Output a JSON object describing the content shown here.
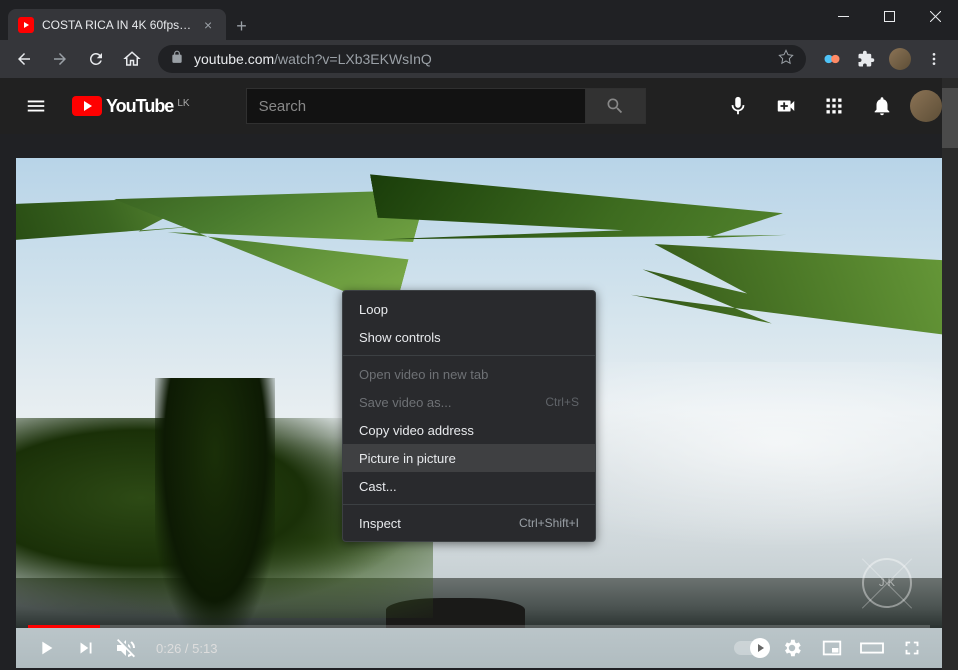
{
  "browser": {
    "tab": {
      "title": "COSTA RICA IN 4K 60fps HDR (U..."
    },
    "url": {
      "domain": "youtube.com",
      "path": "/watch?v=LXb3EKWsInQ"
    }
  },
  "youtube": {
    "logo_text": "YouTube",
    "country": "LK",
    "search_placeholder": "Search"
  },
  "player": {
    "time_current": "0:26",
    "time_separator": " / ",
    "time_total": "5:13",
    "progress_percent": 8,
    "watermark": "J K"
  },
  "context_menu": {
    "items": [
      {
        "label": "Loop",
        "shortcut": "",
        "disabled": false,
        "highlighted": false
      },
      {
        "label": "Show controls",
        "shortcut": "",
        "disabled": false,
        "highlighted": false
      },
      {
        "divider": true
      },
      {
        "label": "Open video in new tab",
        "shortcut": "",
        "disabled": true,
        "highlighted": false
      },
      {
        "label": "Save video as...",
        "shortcut": "Ctrl+S",
        "disabled": true,
        "highlighted": false
      },
      {
        "label": "Copy video address",
        "shortcut": "",
        "disabled": false,
        "highlighted": false
      },
      {
        "label": "Picture in picture",
        "shortcut": "",
        "disabled": false,
        "highlighted": true
      },
      {
        "label": "Cast...",
        "shortcut": "",
        "disabled": false,
        "highlighted": false
      },
      {
        "divider": true
      },
      {
        "label": "Inspect",
        "shortcut": "Ctrl+Shift+I",
        "disabled": false,
        "highlighted": false
      }
    ]
  }
}
